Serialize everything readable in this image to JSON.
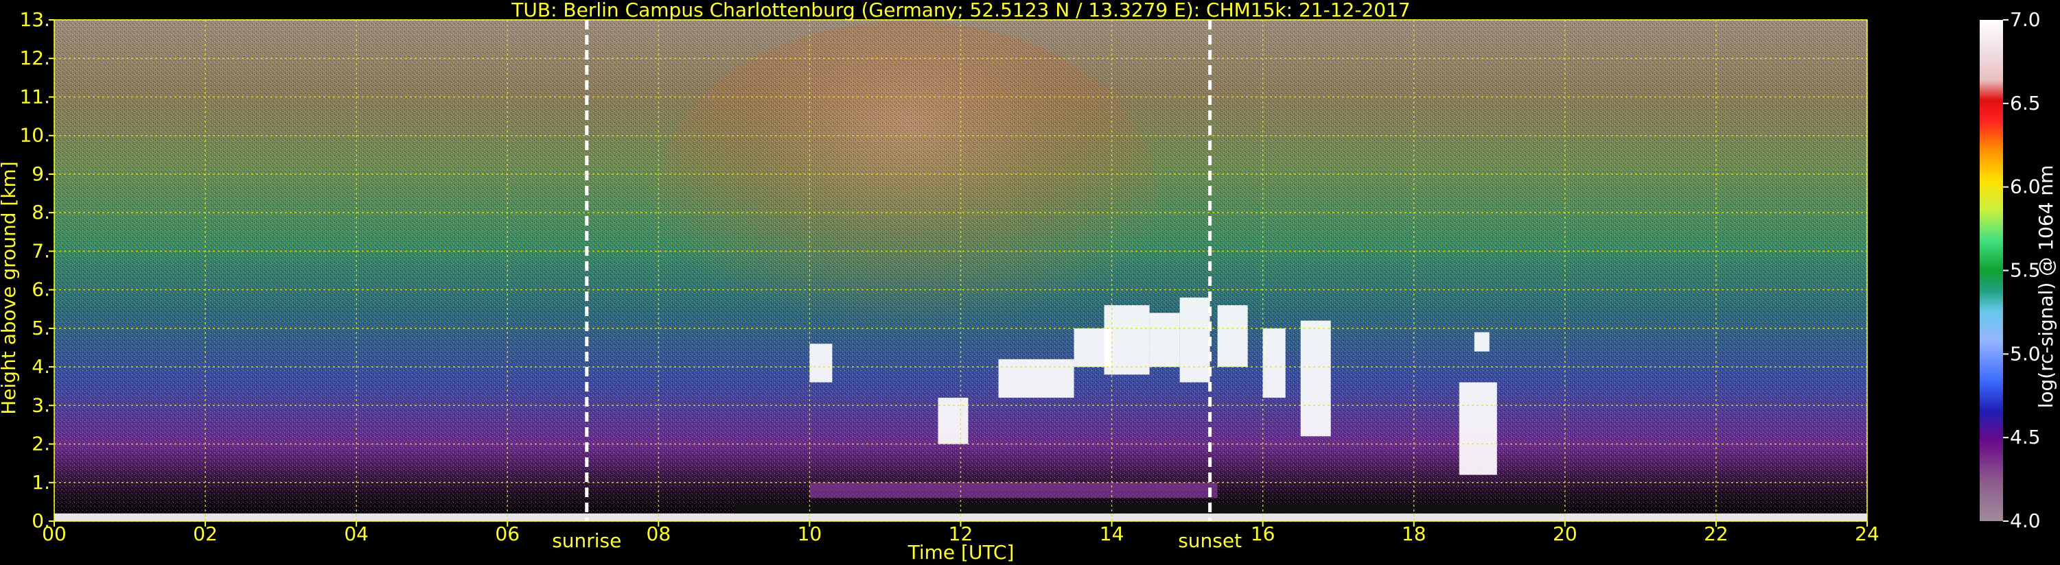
{
  "chart_data": {
    "type": "heatmap",
    "title": "TUB: Berlin Campus Charlottenburg (Germany; 52.5123 N / 13.3279 E):    CHM15k: 21-12-2017",
    "xlabel": "Time [UTC]",
    "ylabel": "Height above ground [km]",
    "xlim": [
      0,
      24
    ],
    "ylim": [
      0,
      13
    ],
    "x_ticks": [
      0,
      2,
      4,
      6,
      8,
      10,
      12,
      14,
      16,
      18,
      20,
      22,
      24
    ],
    "x_tick_labels": [
      "00",
      "02",
      "04",
      "06",
      "08",
      "10",
      "12",
      "14",
      "16",
      "18",
      "20",
      "22",
      "24"
    ],
    "y_ticks": [
      0,
      1,
      2,
      3,
      4,
      5,
      6,
      7,
      8,
      9,
      10,
      11,
      12,
      13
    ],
    "y_tick_labels": [
      "0.",
      "1.",
      "2.",
      "3.",
      "4.",
      "5.",
      "6.",
      "7.",
      "8.",
      "9.",
      "10.",
      "11.",
      "12.",
      "13."
    ],
    "grid": true,
    "annotations": [
      {
        "text": "sunrise",
        "x": 7.05
      },
      {
        "text": "sunset",
        "x": 15.3
      }
    ],
    "colorbar": {
      "label": "log(rc-signal) @ 1064 nm",
      "min": 4.0,
      "max": 7.0,
      "ticks": [
        4.0,
        4.5,
        5.0,
        5.5,
        6.0,
        6.5,
        7.0
      ],
      "tick_labels": [
        "4.0",
        "4.5",
        "5.0",
        "5.5",
        "6.0",
        "6.5",
        "7.0"
      ]
    },
    "cloud_layers": [
      {
        "x0": 10.0,
        "x1": 10.3,
        "y0": 3.6,
        "y1": 4.6
      },
      {
        "x0": 11.7,
        "x1": 12.1,
        "y0": 2.0,
        "y1": 3.2
      },
      {
        "x0": 12.5,
        "x1": 13.5,
        "y0": 3.2,
        "y1": 4.2
      },
      {
        "x0": 13.5,
        "x1": 14.0,
        "y0": 4.0,
        "y1": 5.0
      },
      {
        "x0": 13.9,
        "x1": 14.5,
        "y0": 3.8,
        "y1": 5.6
      },
      {
        "x0": 14.5,
        "x1": 14.9,
        "y0": 4.0,
        "y1": 5.4
      },
      {
        "x0": 14.9,
        "x1": 15.3,
        "y0": 3.6,
        "y1": 5.8
      },
      {
        "x0": 15.4,
        "x1": 15.8,
        "y0": 4.0,
        "y1": 5.6
      },
      {
        "x0": 16.0,
        "x1": 16.3,
        "y0": 3.2,
        "y1": 5.0
      },
      {
        "x0": 16.5,
        "x1": 16.9,
        "y0": 2.2,
        "y1": 5.2
      },
      {
        "x0": 18.6,
        "x1": 19.1,
        "y0": 1.2,
        "y1": 3.6
      },
      {
        "x0": 18.8,
        "x1": 19.0,
        "y0": 4.4,
        "y1": 4.9
      }
    ]
  }
}
